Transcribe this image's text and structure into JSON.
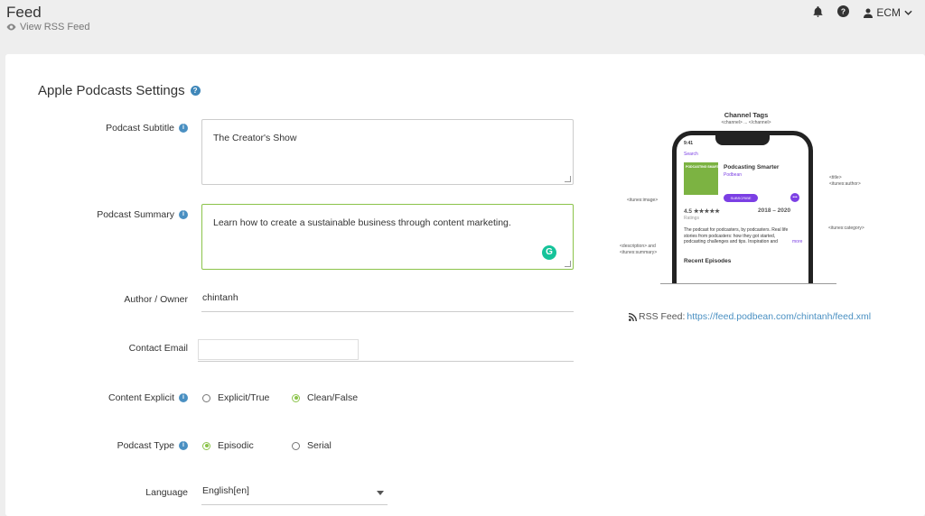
{
  "header": {
    "title": "Feed",
    "view_rss": "View RSS Feed",
    "user": "ECM"
  },
  "section": {
    "title": "Apple Podcasts Settings"
  },
  "form": {
    "subtitle_label": "Podcast Subtitle",
    "subtitle_value": "The Creator's Show",
    "summary_label": "Podcast Summary",
    "summary_value": "Learn how to create a sustainable business through content marketing.",
    "author_label": "Author / Owner",
    "author_value": "chintanh",
    "email_label": "Contact Email",
    "email_value": "",
    "explicit_label": "Content Explicit",
    "explicit_options": [
      "Explicit/True",
      "Clean/False"
    ],
    "explicit_selected": "Clean/False",
    "type_label": "Podcast Type",
    "type_options": [
      "Episodic",
      "Serial"
    ],
    "type_selected": "Episodic",
    "language_label": "Language",
    "language_value": "English[en]"
  },
  "illustration": {
    "title": "Channel Tags",
    "subtitle": "<channel> ... </channel>",
    "time": "9:41",
    "search": "Search",
    "podcast_title": "Podcasting Smarter",
    "podcast_author": "Podbean",
    "cover_text": "PODCASTING SMARTER",
    "subscribe": "SUBSCRIBE",
    "rating": "4.5 ★★★★★",
    "ratings_label": "Ratings",
    "years": "2018 – 2020",
    "description": "The podcast for podcasters, by podcasters. Real life stories from podcasters: how they got started, podcasting challenges and tips. Inspiration and",
    "more": "more",
    "recent": "Recent Episodes",
    "tags": {
      "title": "<title>",
      "author": "<itunes:author>",
      "image": "<itunes:image>",
      "category": "<itunes:category>",
      "description": "<description> and",
      "summary": "<itunes:summary>"
    }
  },
  "rss": {
    "label": "RSS Feed:",
    "url": "https://feed.podbean.com/chintanh/feed.xml"
  },
  "colors": {
    "accent": "#8bc34a",
    "info": "#4a90c2",
    "purple": "#7b3fe4"
  }
}
